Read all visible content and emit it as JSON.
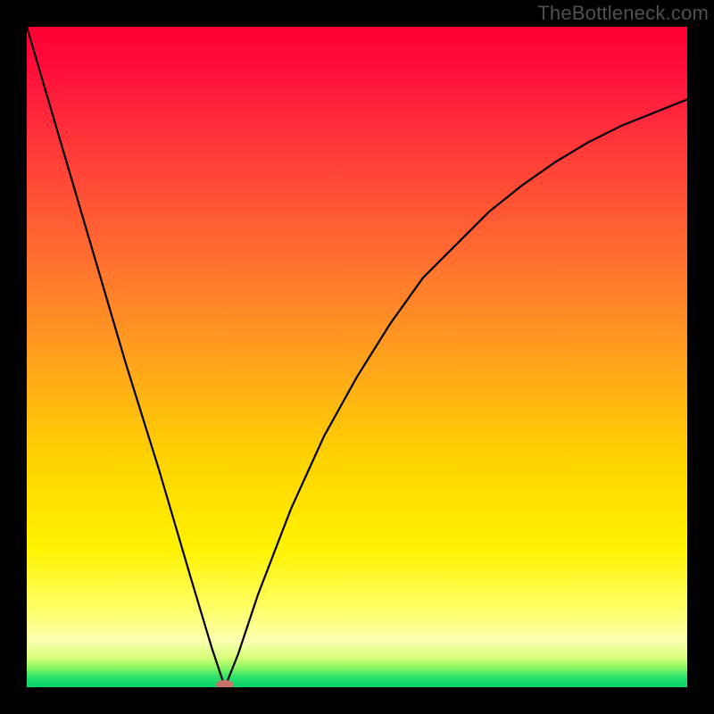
{
  "watermark": "TheBottleneck.com",
  "chart_data": {
    "type": "line",
    "title": "",
    "xlabel": "",
    "ylabel": "",
    "xlim": [
      0,
      100
    ],
    "ylim": [
      0,
      100
    ],
    "grid": false,
    "legend": false,
    "annotations": [],
    "series": [
      {
        "name": "curve",
        "x": [
          0,
          5,
          10,
          15,
          20,
          25,
          28,
          30,
          32,
          35,
          40,
          45,
          50,
          55,
          60,
          65,
          70,
          75,
          80,
          85,
          90,
          95,
          100
        ],
        "y": [
          100,
          83,
          66,
          49,
          33,
          16,
          6,
          0,
          5,
          14,
          27,
          38,
          47,
          55,
          62,
          67,
          72,
          76,
          79.5,
          82.5,
          85,
          87,
          89
        ]
      }
    ],
    "min_marker": {
      "x": 30,
      "y": 0
    },
    "background_gradient": {
      "top": "#ff0033",
      "mid": "#ffd400",
      "bottom": "#07d36a"
    }
  }
}
